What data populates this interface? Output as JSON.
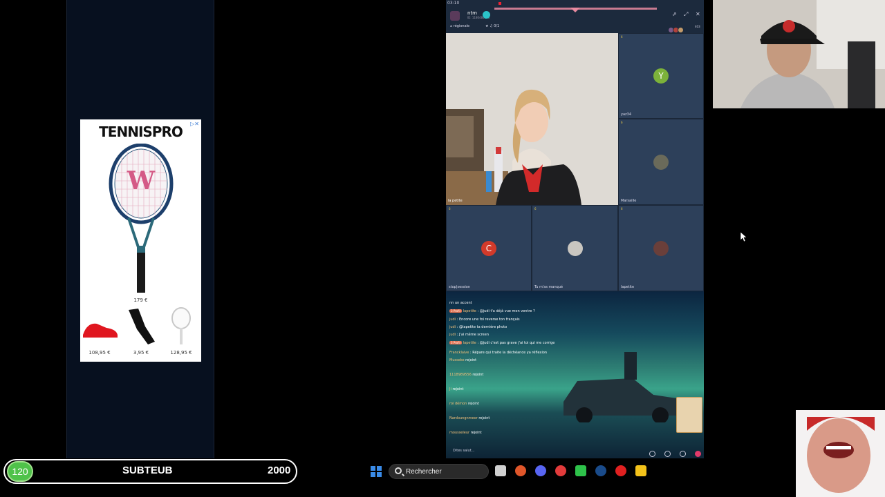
{
  "ad": {
    "brand": "TENNISPRO",
    "main_price": "179 €",
    "products": [
      {
        "price": "108,95 €"
      },
      {
        "price": "3,95 €"
      },
      {
        "price": "128,95 €"
      }
    ]
  },
  "app": {
    "status_time": "03:10",
    "room_name": "ntm",
    "room_id": "ID: 1180484076",
    "tags": [
      "régionale",
      "0/1"
    ],
    "viewer_count": "403",
    "tiles": [
      {
        "label": "yaz34",
        "initial": "Y",
        "color": "#7cb23a",
        "seat": "6"
      },
      {
        "label": "Marsaille",
        "initial": "",
        "color": "#6a6a5a",
        "seat": "6"
      },
      {
        "label": "stop|session",
        "initial": "C",
        "color": "#d23a2a",
        "seat": "6"
      },
      {
        "label": "Tu m'as manqué",
        "initial": "",
        "color": "#c9c6c0",
        "seat": "6"
      },
      {
        "label": "lapetite",
        "initial": "",
        "color": "#6a3f3a",
        "seat": "6"
      }
    ],
    "main_video_label": "la petite"
  },
  "chat": {
    "messages": [
      {
        "name": "",
        "text": "nn un accent"
      },
      {
        "name": "lapetite",
        "badge": "3 Profil",
        "text": "@judi t'a déjà vue mon ventre ?"
      },
      {
        "name": "judi",
        "text": "Encore une foi reverse ton français"
      },
      {
        "name": "judi",
        "text": "@lapetite ta dernière photo"
      },
      {
        "name": "judi",
        "text": "J'ai même screen"
      },
      {
        "name": "lapetite",
        "badge": "3 Profil",
        "text": "@judi c'est pas grave j'ai toi qui me corrige"
      },
      {
        "name": "Francklaive",
        "text": "Répare qui traite la déchéance ya réflexion"
      },
      {
        "name": "Musseke",
        "text": "rejoint"
      },
      {
        "name": "1118989556",
        "text": "rejoint"
      },
      {
        "name": "Ji",
        "text": "rejoint"
      },
      {
        "name": "roi démon",
        "text": "rejoint"
      },
      {
        "name": "Nardoungnmeor",
        "text": "rejoint"
      },
      {
        "name": "mousseleur",
        "text": "rejoint"
      }
    ],
    "input_placeholder": "Dites salut..."
  },
  "counter": {
    "current": "120",
    "name": "SUBTEUB",
    "goal": "2000"
  },
  "taskbar": {
    "search_placeholder": "Rechercher"
  },
  "colors": {
    "counter_green": "#4fc24a",
    "windows_blue": "#3a8be8",
    "app_bg": "#243448"
  }
}
